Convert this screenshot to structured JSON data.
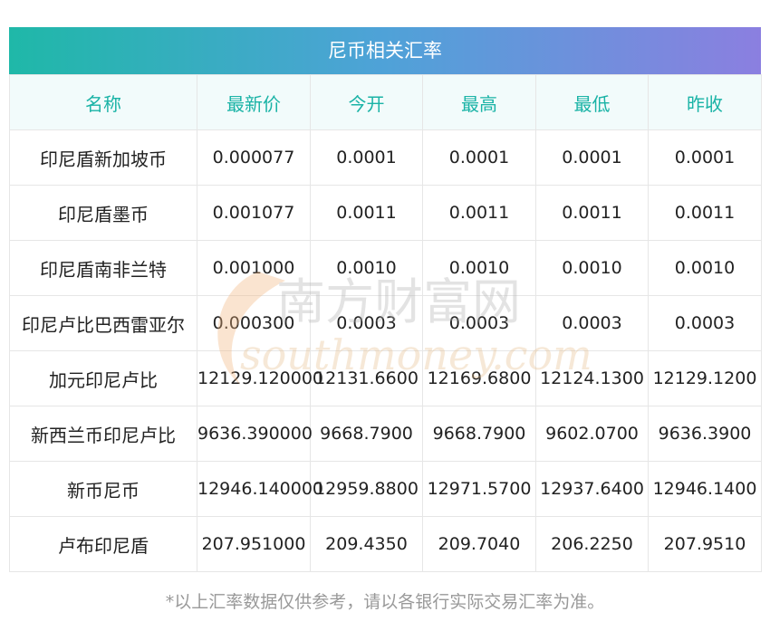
{
  "title": "尼币相关汇率",
  "columns": [
    "名称",
    "最新价",
    "今开",
    "最高",
    "最低",
    "昨收"
  ],
  "rows": [
    [
      "印尼盾新加坡币",
      "0.000077",
      "0.0001",
      "0.0001",
      "0.0001",
      "0.0001"
    ],
    [
      "印尼盾墨币",
      "0.001077",
      "0.0011",
      "0.0011",
      "0.0011",
      "0.0011"
    ],
    [
      "印尼盾南非兰特",
      "0.001000",
      "0.0010",
      "0.0010",
      "0.0010",
      "0.0010"
    ],
    [
      "印尼卢比巴西雷亚尔",
      "0.000300",
      "0.0003",
      "0.0003",
      "0.0003",
      "0.0003"
    ],
    [
      "加元印尼卢比",
      "12129.120000",
      "12131.6600",
      "12169.6800",
      "12124.1300",
      "12129.1200"
    ],
    [
      "新西兰币印尼卢比",
      "9636.390000",
      "9668.7900",
      "9668.7900",
      "9602.0700",
      "9636.3900"
    ],
    [
      "新币尼币",
      "12946.140000",
      "12959.8800",
      "12971.5700",
      "12937.6400",
      "12946.1400"
    ],
    [
      "卢布印尼盾",
      "207.951000",
      "209.4350",
      "209.7040",
      "206.2250",
      "207.9510"
    ]
  ],
  "footnote": "*以上汇率数据仅供参考，请以各银行实际交易汇率为准。",
  "watermark": {
    "cn": "南方财富网",
    "en": "southmoney.com"
  }
}
